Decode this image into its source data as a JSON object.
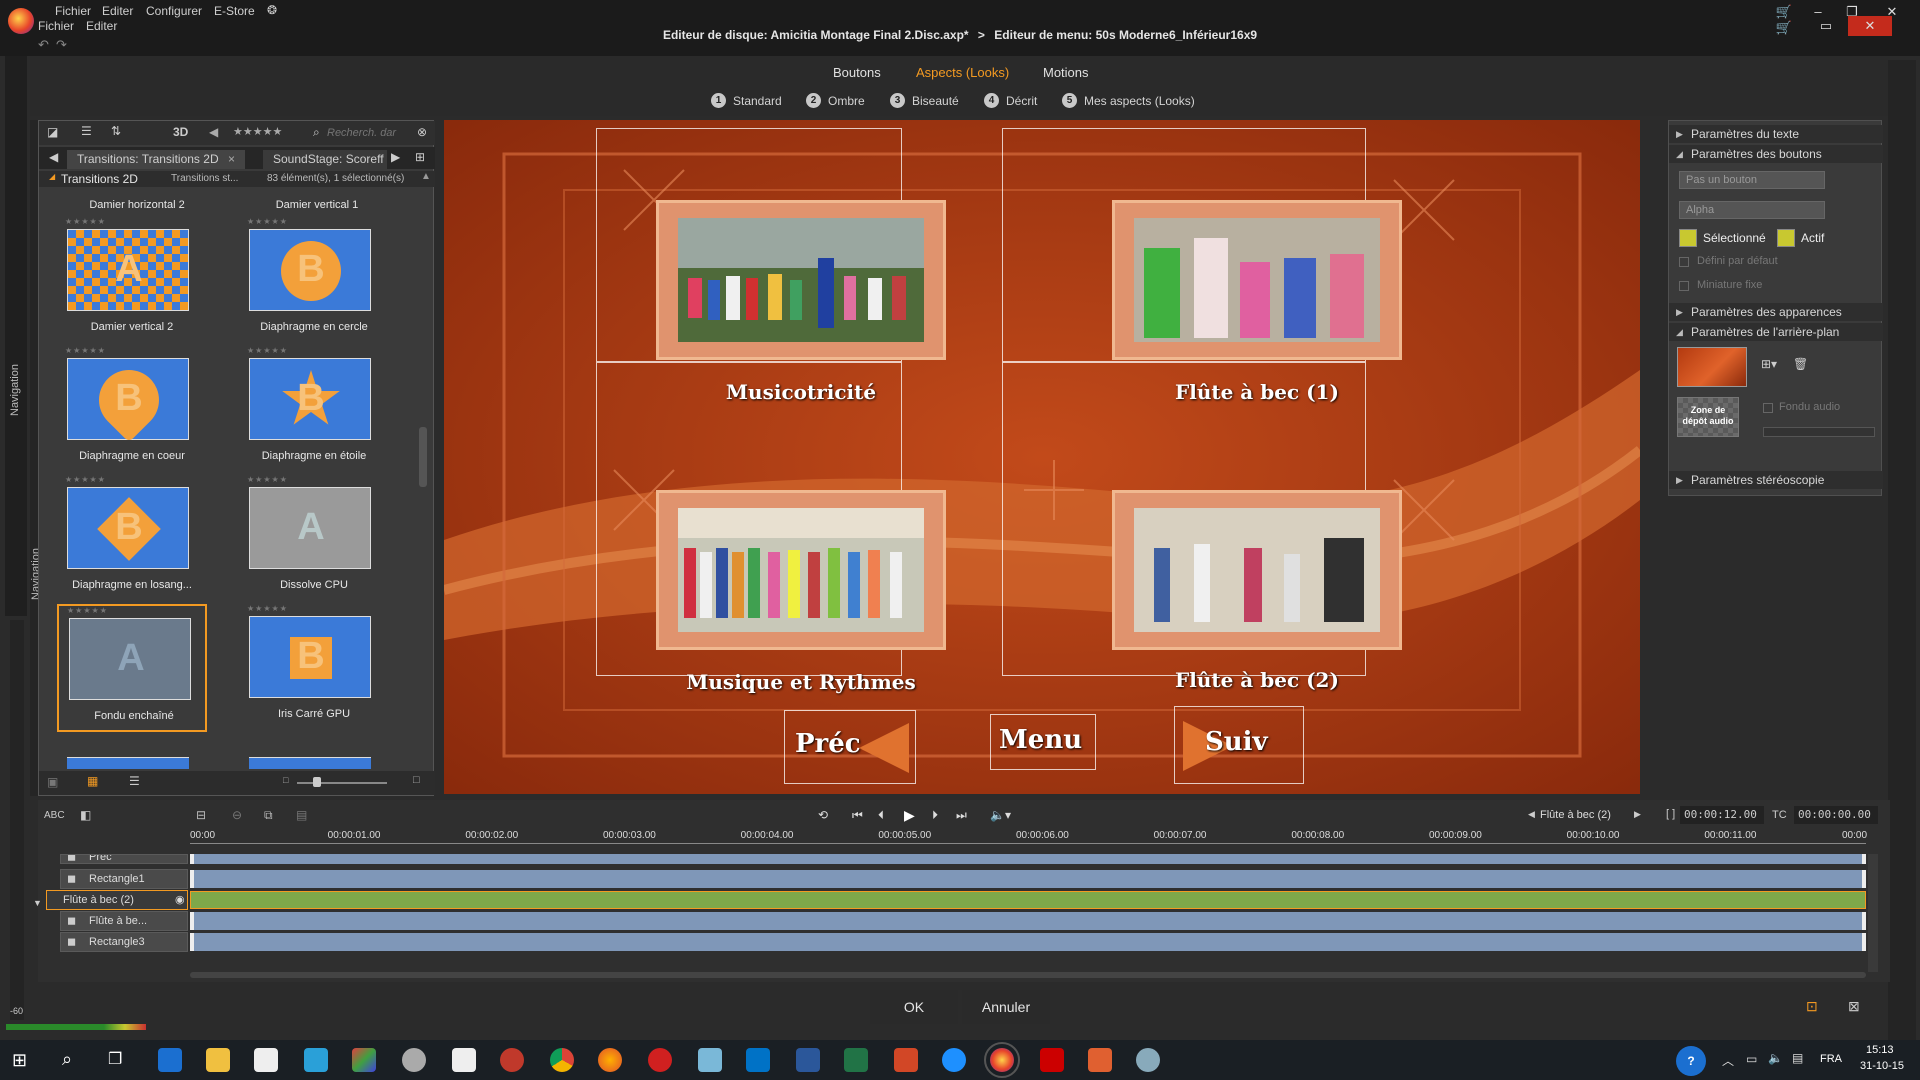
{
  "app": {
    "menu_top": [
      "Fichier",
      "Editer",
      "Configurer",
      "E-Store"
    ],
    "menu_bottom": [
      "Fichier",
      "Editer"
    ],
    "path_disc": "Editeur de disque: Amicitia Montage Final 2.Disc.axp*",
    "path_sep": ">",
    "path_menu": "Editeur de menu: 50s Moderne6_Inférieur16x9"
  },
  "tabs": [
    {
      "label": "Boutons"
    },
    {
      "label": "Aspects (Looks)"
    },
    {
      "label": "Motions"
    }
  ],
  "substeps": [
    {
      "num": "1",
      "label": "Standard"
    },
    {
      "num": "2",
      "label": "Ombre"
    },
    {
      "num": "3",
      "label": "Biseauté"
    },
    {
      "num": "4",
      "label": "Décrit"
    },
    {
      "num": "5",
      "label": "Mes aspects (Looks)"
    }
  ],
  "side": {
    "nav1": "Navigation",
    "nav2": "Navigation"
  },
  "library": {
    "tool_3d": "3D",
    "stars": "★★★★★",
    "search_placeholder": "Recherch. dar",
    "tab1": "Transitions: Transitions 2D",
    "tab1_close": "×",
    "tab2": "SoundStage: Scoreff",
    "folder": "Transitions 2D",
    "crumb": "Transitions st...",
    "count": "83 élément(s), 1 sélectionné(s)",
    "top_row": [
      "Damier horizontal 2",
      "Damier vertical 1"
    ],
    "tiles": [
      {
        "name": "Damier vertical 2",
        "letter": "A"
      },
      {
        "name": "Diaphragme en cercle",
        "letter": "B"
      },
      {
        "name": "Diaphragme en coeur",
        "letter": "B"
      },
      {
        "name": "Diaphragme en étoile",
        "letter": "B"
      },
      {
        "name": "Diaphragme en losang...",
        "letter": "B"
      },
      {
        "name": "Dissolve CPU",
        "letter": "A"
      },
      {
        "name": "Fondu enchaîné",
        "letter": "A"
      },
      {
        "name": "Iris Carré GPU",
        "letter": "B"
      }
    ],
    "tile_stars": "★★★★★"
  },
  "preview": {
    "buttons": [
      {
        "caption": "Musicotricité"
      },
      {
        "caption": "Flûte à bec (1)"
      },
      {
        "caption": "Musique et Rythmes"
      },
      {
        "caption": "Flûte à bec (2)"
      }
    ],
    "nav": {
      "prev": "Préc",
      "menu": "Menu",
      "next": "Suiv"
    }
  },
  "props": {
    "sec_text": "Paramètres du texte",
    "sec_buttons": "Paramètres des boutons",
    "dd1": "Pas un bouton",
    "dd2": "Alpha",
    "selected_label": "Sélectionné",
    "active_label": "Actif",
    "default_label": "Défini par défaut",
    "thumb_label": "Miniature fixe",
    "sec_appear": "Paramètres des apparences",
    "sec_bg": "Paramètres de l'arrière-plan",
    "audio_drop": "Zone de dépôt audio",
    "audio_fade": "Fondu audio",
    "sec_stereo": "Paramètres stéréoscopie"
  },
  "timeline": {
    "abc": "ABC",
    "current_item": "Flûte à bec (2)",
    "duration": "00:00:12.00",
    "tc_label": "TC",
    "tc": "00:00:00.00",
    "ticks": [
      "00:00",
      "00:00:01.00",
      "00:00:02.00",
      "00:00:03.00",
      "00:00:04.00",
      "00:00:05.00",
      "00:00:06.00",
      "00:00:07.00",
      "00:00:08.00",
      "00:00:09.00",
      "00:00:10.00",
      "00:00:11.00",
      "00:00"
    ],
    "tracks": [
      {
        "name": "Préc"
      },
      {
        "name": "Rectangle1"
      },
      {
        "name": "Flûte à bec (2)"
      },
      {
        "name": "Flûte à be..."
      },
      {
        "name": "Rectangle3"
      }
    ],
    "level": "-60"
  },
  "dialog": {
    "ok": "OK",
    "cancel": "Annuler"
  },
  "taskbar": {
    "lang": "FRA",
    "time": "15:13",
    "date": "31-10-15"
  },
  "colors": {
    "accent": "#f39a22",
    "preview_bg": "#a6360f",
    "track": "#7f97b8",
    "track_active": "#7ea84a"
  }
}
